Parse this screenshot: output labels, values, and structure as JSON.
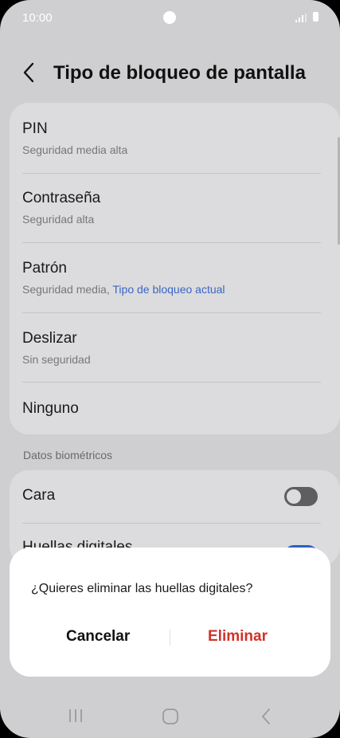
{
  "status_bar": {
    "time": "10:00"
  },
  "header": {
    "title": "Tipo de bloqueo de pantalla"
  },
  "lock_types": [
    {
      "title": "PIN",
      "subtitle": "Seguridad media alta"
    },
    {
      "title": "Contraseña",
      "subtitle": "Seguridad alta"
    },
    {
      "title": "Patrón",
      "subtitle": "Seguridad media,",
      "subtitle_highlight": "Tipo de bloqueo actual"
    },
    {
      "title": "Deslizar",
      "subtitle": "Sin seguridad"
    },
    {
      "title": "Ninguno"
    }
  ],
  "biometrics": {
    "section_label": "Datos biométricos",
    "items": [
      {
        "title": "Cara",
        "enabled": false
      },
      {
        "title": "Huellas digitales",
        "enabled": true
      }
    ]
  },
  "dialog": {
    "message": "¿Quieres eliminar las huellas digitales?",
    "cancel_label": "Cancelar",
    "confirm_label": "Eliminar"
  },
  "colors": {
    "accent": "#2f5fc3",
    "danger": "#d0322a",
    "link": "#3a66c4"
  },
  "icons": [
    "back-icon",
    "recent-apps-icon",
    "home-icon",
    "nav-back-icon"
  ]
}
